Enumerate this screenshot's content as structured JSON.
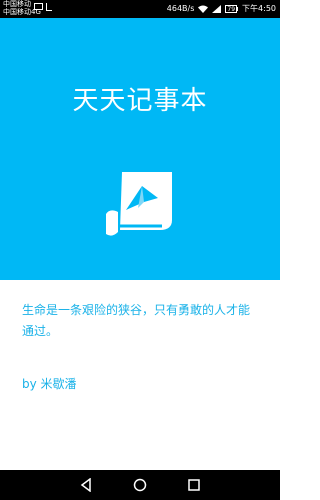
{
  "status_bar": {
    "carrier_line1": "中国移动",
    "carrier_line2": "中国移动4G",
    "net_speed": "464B/s",
    "battery_level": "79",
    "time": "下午4:50"
  },
  "splash": {
    "title": "天天记事本",
    "logo_icon": "note-paper-plane-icon"
  },
  "quote": {
    "text": "生命是一条艰险的狭谷，只有勇敢的人才能通过。",
    "author": "by 米歇潘"
  },
  "nav_bar": {
    "icons": [
      "back-icon",
      "home-icon",
      "recent-apps-icon"
    ]
  },
  "colors": {
    "brand": "#00b8f5",
    "quote_text": "#1ab2e8"
  }
}
